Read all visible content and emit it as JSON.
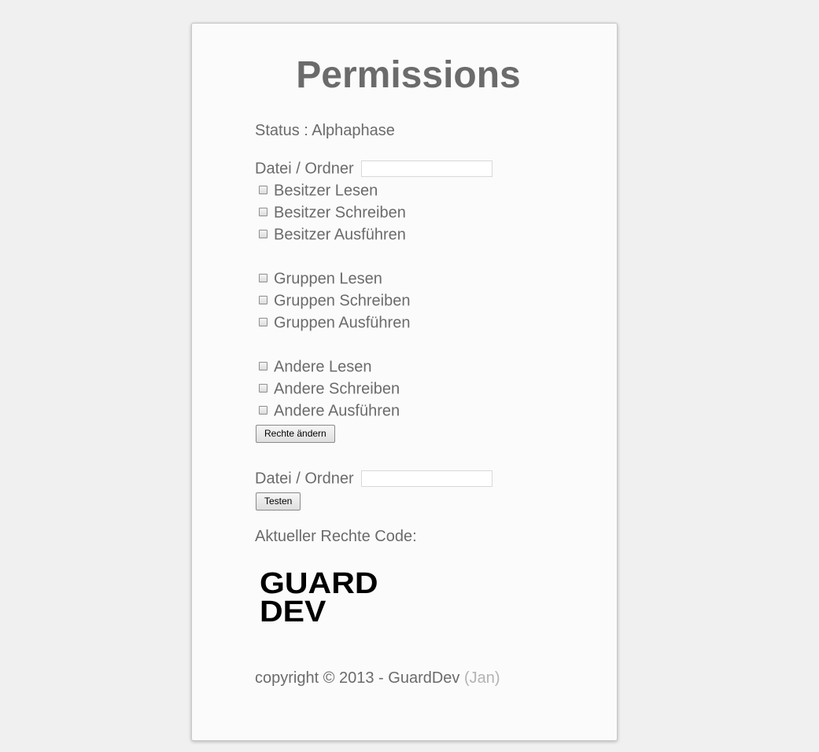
{
  "page": {
    "title": "Permissions",
    "status": "Status : Alphaphase"
  },
  "form1": {
    "path_label": "Datei / Ordner",
    "path_value": "",
    "checkboxes": [
      {
        "label": "Besitzer Lesen",
        "checked": false
      },
      {
        "label": "Besitzer Schreiben",
        "checked": false
      },
      {
        "label": "Besitzer Ausführen",
        "checked": false
      },
      {
        "label": "Gruppen Lesen",
        "checked": false
      },
      {
        "label": "Gruppen Schreiben",
        "checked": false
      },
      {
        "label": "Gruppen Ausführen",
        "checked": false
      },
      {
        "label": "Andere Lesen",
        "checked": false
      },
      {
        "label": "Andere Schreiben",
        "checked": false
      },
      {
        "label": "Andere Ausführen",
        "checked": false
      }
    ],
    "submit_label": "Rechte ändern"
  },
  "form2": {
    "path_label": "Datei / Ordner",
    "path_value": "",
    "submit_label": "Testen"
  },
  "result": {
    "label": "Aktueller Rechte Code:"
  },
  "logo": {
    "line1": "GUARD",
    "line2": "DEV"
  },
  "footer": {
    "copyright": "copyright © 2013 - GuardDev",
    "author": "(Jan)"
  },
  "colors": {
    "background": "#f0f0f0",
    "card": "#fbfbfb",
    "text": "#6b6b6b",
    "muted": "#b3b3b3"
  }
}
